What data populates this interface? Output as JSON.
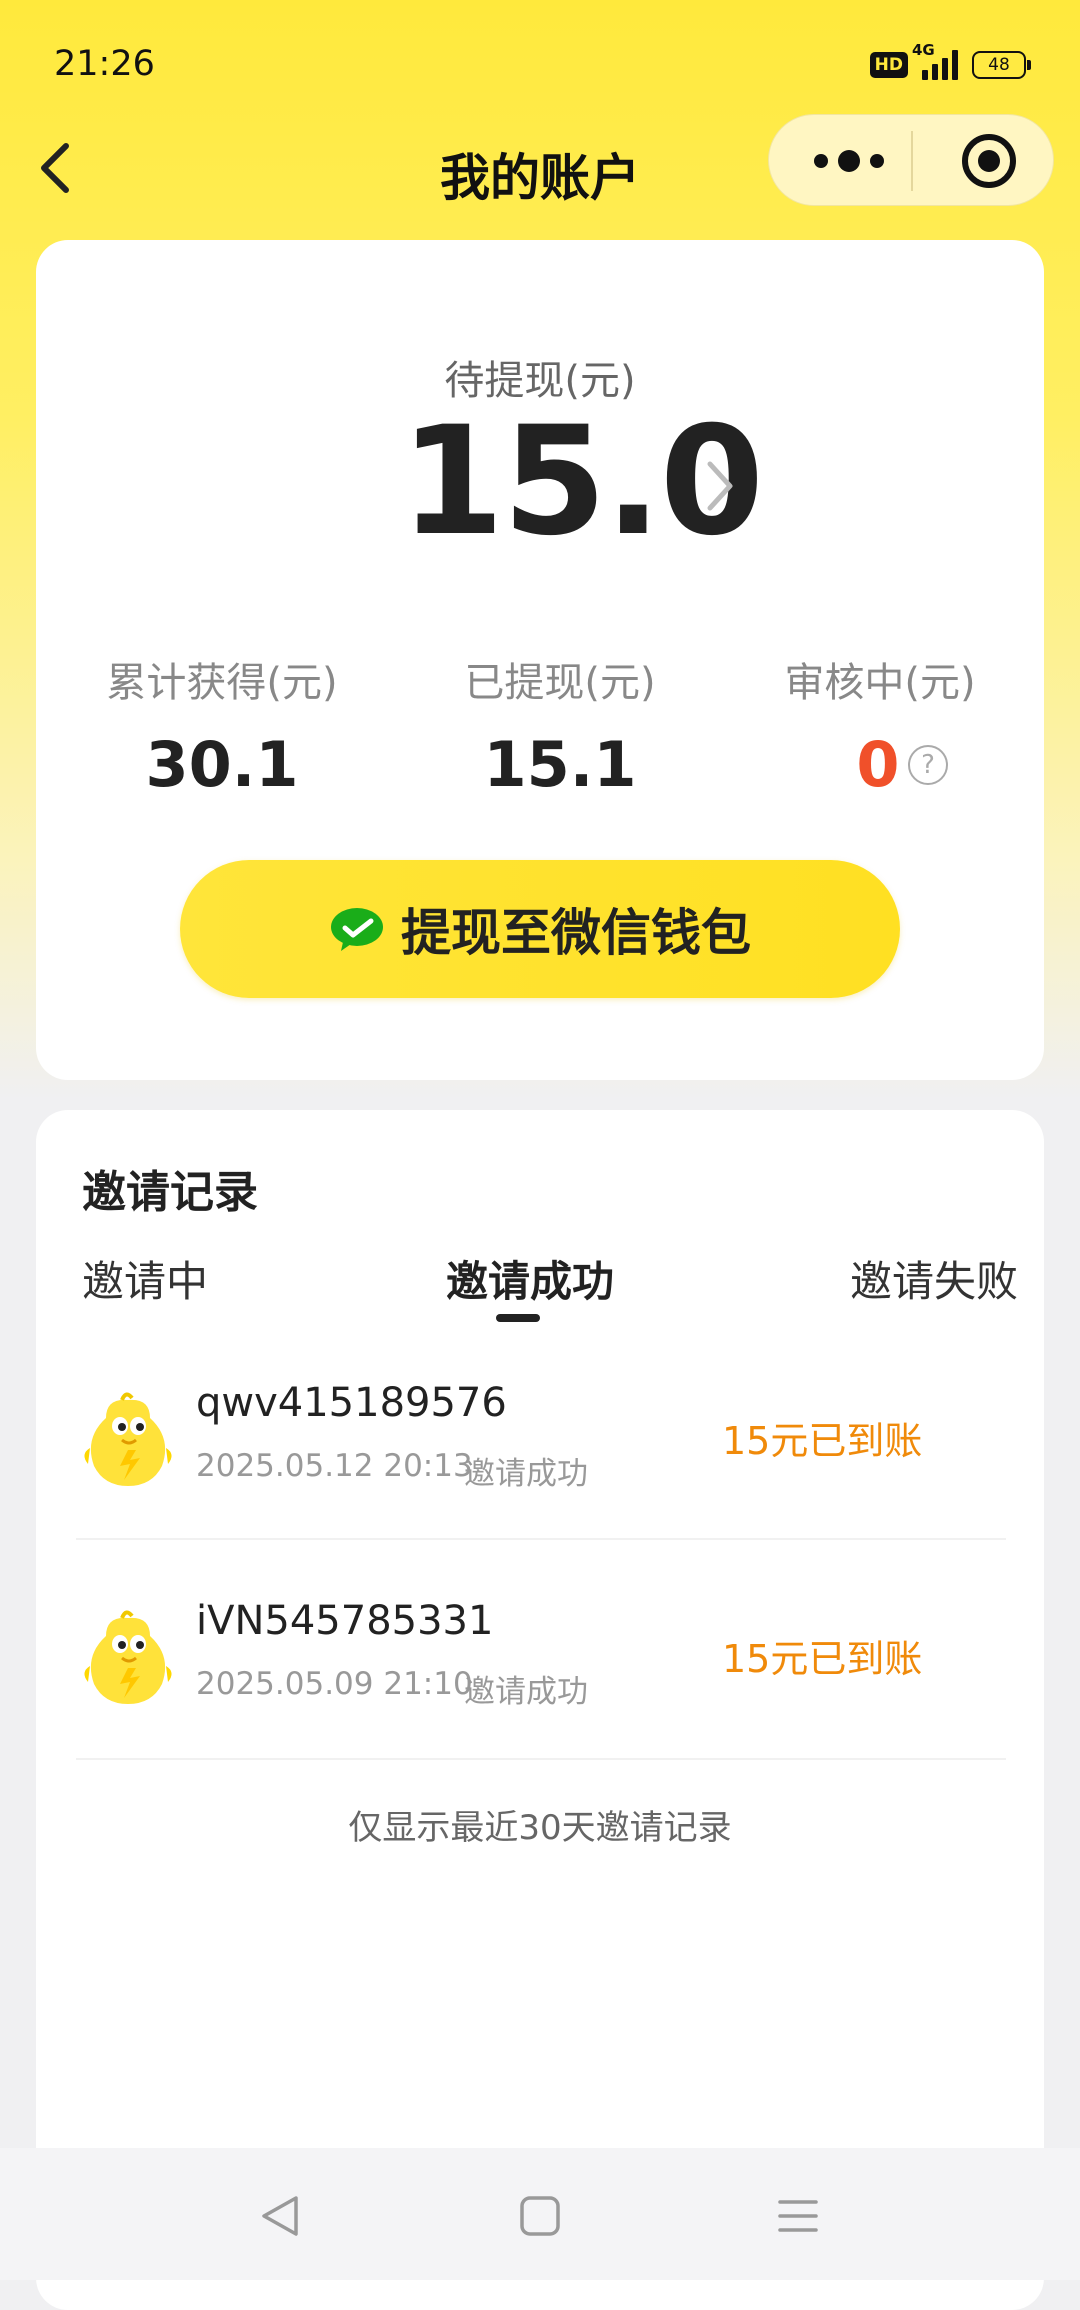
{
  "status_bar": {
    "time": "21:26",
    "hd": "HD",
    "network": "4G",
    "battery": "48"
  },
  "nav": {
    "title": "我的账户",
    "back_icon": "chevron-left-icon",
    "more_icon": "more-dots-icon",
    "close_icon": "record-target-icon"
  },
  "account": {
    "pending_label": "待提现(元)",
    "pending_amount": "15.0",
    "stats": [
      {
        "label": "累计获得(元)",
        "value": "30.1"
      },
      {
        "label": "已提现(元)",
        "value": "15.1"
      },
      {
        "label": "审核中(元)",
        "value": "0"
      }
    ],
    "help_mark": "?",
    "withdraw_button": "提现至微信钱包",
    "colors": {
      "accent": "#ffe53a",
      "zero_value": "#f0502a",
      "reward": "#f08a0a",
      "wechat": "#1aad19"
    }
  },
  "invites": {
    "title": "邀请记录",
    "tabs": [
      {
        "label": "邀请中"
      },
      {
        "label": "邀请成功",
        "active": true
      },
      {
        "label": "邀请失败"
      }
    ],
    "records": [
      {
        "user": "qwv415189576",
        "time": "2025.05.12 20:13",
        "status": "邀请成功",
        "reward": "15元已到账"
      },
      {
        "user": "iVN545785331",
        "time": "2025.05.09 21:10",
        "status": "邀请成功",
        "reward": "15元已到账"
      }
    ],
    "footnote": "仅显示最近30天邀请记录"
  },
  "system_nav": {
    "back_icon": "triangle-back-icon",
    "home_icon": "square-home-icon",
    "menu_icon": "menu-lines-icon"
  }
}
